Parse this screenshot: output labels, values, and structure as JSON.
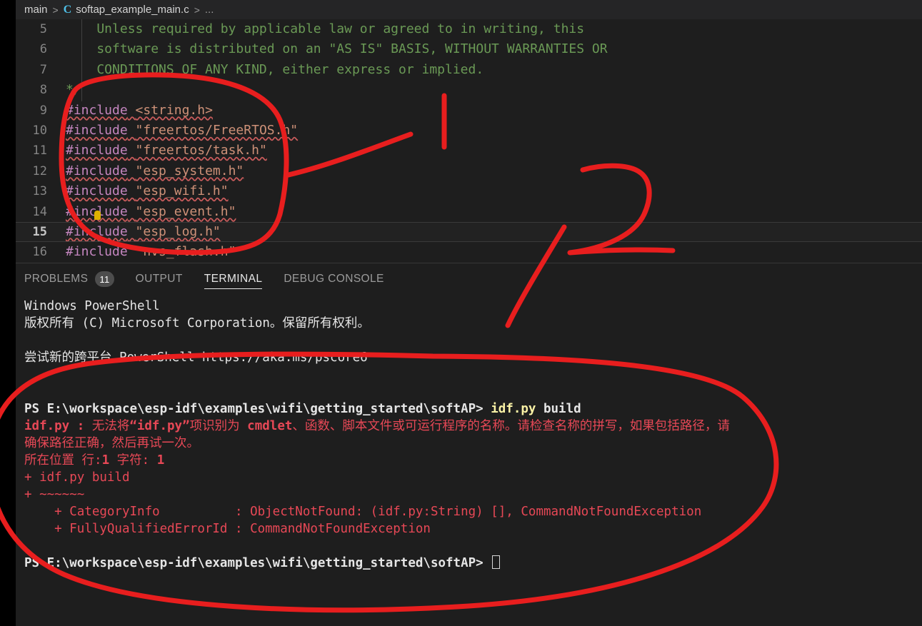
{
  "window": {
    "app": "vscode",
    "theme_colors": {
      "background": "#1e1e1e",
      "panel_background": "#1e1e1e",
      "breadcrumb_background": "#252526",
      "accent": "#4fc1e9",
      "annotation_red": "#e81e1e",
      "error_red": "#e74856",
      "comment_green": "#6a9955",
      "preprocessor_purple": "#c586c0",
      "string_peach": "#ce9178",
      "command_yellow": "#f9f1a5"
    }
  },
  "breadcrumb": {
    "root": "main",
    "separator": ">",
    "file_icon": "C",
    "file": "softap_example_main.c",
    "ellipsis": "..."
  },
  "editor": {
    "lines": [
      {
        "num": "5",
        "active": false,
        "segments": [
          {
            "text": "    Unless required by applicable law or agreed to in writing, this",
            "cls": "tok-comment"
          }
        ]
      },
      {
        "num": "6",
        "active": false,
        "segments": [
          {
            "text": "    software is distributed on an \"AS IS\" BASIS, WITHOUT WARRANTIES OR",
            "cls": "tok-comment"
          }
        ]
      },
      {
        "num": "7",
        "active": false,
        "segments": [
          {
            "text": "    CONDITIONS OF ANY KIND, either express or implied.",
            "cls": "tok-comment"
          }
        ]
      },
      {
        "num": "8",
        "active": false,
        "segments": [
          {
            "text": "*/",
            "cls": "tok-comment"
          }
        ]
      },
      {
        "num": "9",
        "active": false,
        "segments": [
          {
            "text": "#include",
            "cls": "tok-pp squig"
          },
          {
            "text": " ",
            "cls": "squig"
          },
          {
            "text": "<string.h>",
            "cls": "tok-str squig"
          }
        ]
      },
      {
        "num": "10",
        "active": false,
        "segments": [
          {
            "text": "#include",
            "cls": "tok-pp squig"
          },
          {
            "text": " ",
            "cls": "squig"
          },
          {
            "text": "\"freertos/FreeRTOS.h\"",
            "cls": "tok-str squig"
          }
        ]
      },
      {
        "num": "11",
        "active": false,
        "segments": [
          {
            "text": "#include",
            "cls": "tok-pp squig"
          },
          {
            "text": " ",
            "cls": "squig"
          },
          {
            "text": "\"freertos/task.h\"",
            "cls": "tok-str squig"
          }
        ]
      },
      {
        "num": "12",
        "active": false,
        "segments": [
          {
            "text": "#include",
            "cls": "tok-pp squig"
          },
          {
            "text": " ",
            "cls": "squig"
          },
          {
            "text": "\"esp_system.h\"",
            "cls": "tok-str squig"
          }
        ]
      },
      {
        "num": "13",
        "active": false,
        "segments": [
          {
            "text": "#include",
            "cls": "tok-pp squig"
          },
          {
            "text": " ",
            "cls": "squig"
          },
          {
            "text": "\"esp_wifi.h\"",
            "cls": "tok-str squig"
          }
        ]
      },
      {
        "num": "14",
        "active": false,
        "segments": [
          {
            "text": "#include",
            "cls": "tok-pp squig"
          },
          {
            "text": " ",
            "cls": "squig"
          },
          {
            "text": "\"esp_event.h\"",
            "cls": "tok-str squig"
          }
        ]
      },
      {
        "num": "15",
        "active": true,
        "segments": [
          {
            "text": "#include",
            "cls": "tok-pp squig"
          },
          {
            "text": " ",
            "cls": "squig"
          },
          {
            "text": "\"esp_log.h\"",
            "cls": "tok-str squig"
          }
        ]
      },
      {
        "num": "16",
        "active": false,
        "segments": [
          {
            "text": "#include",
            "cls": "tok-pp"
          },
          {
            "text": " ",
            "cls": ""
          },
          {
            "text": "\"nvs_flash.h\"",
            "cls": "tok-str"
          }
        ]
      }
    ]
  },
  "panel": {
    "tabs": [
      {
        "label": "PROBLEMS",
        "badge": "11",
        "active": false
      },
      {
        "label": "OUTPUT",
        "badge": null,
        "active": false
      },
      {
        "label": "TERMINAL",
        "badge": null,
        "active": true
      },
      {
        "label": "DEBUG CONSOLE",
        "badge": null,
        "active": false
      }
    ]
  },
  "terminal": {
    "lines": [
      {
        "type": "text",
        "spans": [
          {
            "text": "Windows PowerShell",
            "cls": "t-white"
          }
        ]
      },
      {
        "type": "text",
        "spans": [
          {
            "text": "版权所有 (C) Microsoft Corporation。保留所有权利。",
            "cls": "t-white"
          }
        ]
      },
      {
        "type": "blank",
        "spans": []
      },
      {
        "type": "text",
        "spans": [
          {
            "text": "尝试新的跨平台 PowerShell https://aka.ms/pscore6",
            "cls": "t-white"
          }
        ]
      },
      {
        "type": "blank",
        "spans": []
      },
      {
        "type": "blank",
        "spans": []
      },
      {
        "type": "text",
        "spans": [
          {
            "text": "PS E:\\workspace\\esp-idf\\examples\\wifi\\getting_started\\softAP> ",
            "cls": "t-bold"
          },
          {
            "text": "idf.py",
            "cls": "t-cmd"
          },
          {
            "text": " build",
            "cls": "t-bold"
          }
        ]
      },
      {
        "type": "text",
        "spans": [
          {
            "text": "idf.py : ",
            "cls": "t-err-strong"
          },
          {
            "text": "无法将",
            "cls": "t-err"
          },
          {
            "text": "“idf.py”",
            "cls": "t-err-strong"
          },
          {
            "text": "项识别为 ",
            "cls": "t-err"
          },
          {
            "text": "cmdlet",
            "cls": "t-err-strong"
          },
          {
            "text": "、函数、脚本文件或可运行程序的名称。请检查名称的拼写，如果包括路径，请",
            "cls": "t-err"
          }
        ]
      },
      {
        "type": "text",
        "spans": [
          {
            "text": "确保路径正确，然后再试一次。",
            "cls": "t-err"
          }
        ]
      },
      {
        "type": "text",
        "spans": [
          {
            "text": "所在位置 行:",
            "cls": "t-err"
          },
          {
            "text": "1",
            "cls": "t-err-strong"
          },
          {
            "text": " 字符: ",
            "cls": "t-err"
          },
          {
            "text": "1",
            "cls": "t-err-strong"
          }
        ]
      },
      {
        "type": "text",
        "spans": [
          {
            "text": "+ idf.py build",
            "cls": "t-err"
          }
        ]
      },
      {
        "type": "text",
        "spans": [
          {
            "text": "+ ~~~~~~",
            "cls": "t-err"
          }
        ]
      },
      {
        "type": "text",
        "spans": [
          {
            "text": "    + CategoryInfo          : ObjectNotFound: (idf.py:String) [], CommandNotFoundException",
            "cls": "t-err"
          }
        ]
      },
      {
        "type": "text",
        "spans": [
          {
            "text": "    + FullyQualifiedErrorId : CommandNotFoundException",
            "cls": "t-err"
          }
        ]
      },
      {
        "type": "blank",
        "spans": []
      },
      {
        "type": "prompt",
        "spans": [
          {
            "text": "PS E:\\workspace\\esp-idf\\examples\\wifi\\getting_started\\softAP> ",
            "cls": "t-bold"
          }
        ]
      }
    ]
  },
  "annotations": {
    "color": "#e81e1e",
    "marks": [
      {
        "id": "1",
        "label": "1",
        "target": "include-block",
        "shape": "circle-with-leader"
      },
      {
        "id": "2",
        "label": "2",
        "target": "terminal-error-block",
        "shape": "ellipse-with-leader"
      }
    ]
  }
}
